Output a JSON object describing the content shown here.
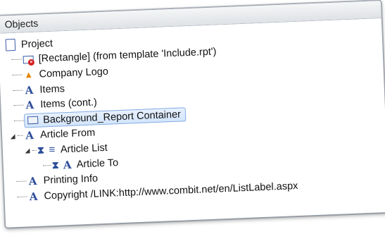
{
  "panel": {
    "title": "Objects"
  },
  "tree": {
    "root": {
      "label": "Project",
      "icon": "document-icon"
    },
    "items": [
      {
        "label": "[Rectangle] (from template 'Include.rpt')",
        "icon": "rectangle-error-icon",
        "depth": 1
      },
      {
        "label": "Company Logo",
        "icon": "image-icon",
        "depth": 1
      },
      {
        "label": "Items",
        "icon": "text-object-icon",
        "depth": 1
      },
      {
        "label": "Items (cont.)",
        "icon": "text-object-icon",
        "depth": 1
      },
      {
        "label": "Background_Report Container",
        "icon": "container-icon",
        "depth": 1,
        "selected": true
      },
      {
        "label": "Article From",
        "icon": "text-object-icon",
        "depth": 1,
        "expanded": true
      },
      {
        "label": "Article List",
        "icon": "table-icon",
        "depth": 2,
        "expanded": true
      },
      {
        "label": "Article To",
        "icon": "text-object-icon",
        "depth": 3
      },
      {
        "label": "Printing Info",
        "icon": "text-object-icon",
        "depth": 1
      },
      {
        "label": "Copyright /LINK:http://www.combit.net/en/ListLabel.aspx",
        "icon": "text-object-icon",
        "depth": 1
      }
    ]
  },
  "colors": {
    "selection_bg": "#d3e5fb",
    "selection_border": "#7fa9e3",
    "icon_blue": "#2c4d9a",
    "error_red": "#d61f1f",
    "logo_orange": "#e18400"
  }
}
